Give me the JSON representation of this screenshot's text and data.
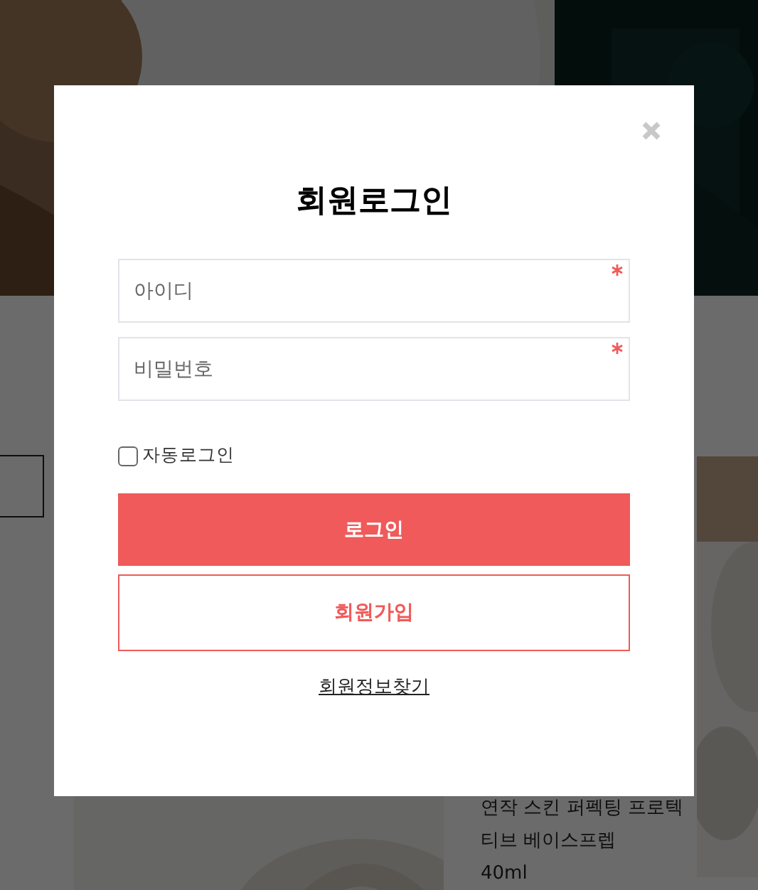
{
  "background": {
    "product": {
      "name": "연작 스킨 퍼펙팅 프로텍티브 베이스프렙",
      "size": "40ml"
    }
  },
  "modal": {
    "title": "회원로그인",
    "fields": [
      {
        "placeholder": "아이디",
        "required": true
      },
      {
        "placeholder": "비밀번호",
        "required": true
      }
    ],
    "auto_login": {
      "label": "자동로그인",
      "checked": false
    },
    "login_button": "로그인",
    "signup_button": "회원가입",
    "find_link": "회원정보찾기"
  }
}
